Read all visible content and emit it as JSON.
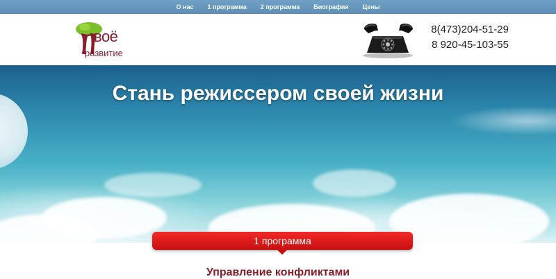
{
  "nav": {
    "items": [
      {
        "label": "О нас"
      },
      {
        "label": "1 программа"
      },
      {
        "label": "2 программа"
      },
      {
        "label": "Биография"
      },
      {
        "label": "Цены"
      }
    ]
  },
  "header": {
    "logo": {
      "word1": "воё",
      "word2": "развитие"
    },
    "phones": [
      "8(473)204-51-29",
      "8 920-45-103-55"
    ]
  },
  "hero": {
    "title": "Стань режиссером своей жизни"
  },
  "program": {
    "tab_label": "1 программа",
    "heading": "Управление конфликтами"
  },
  "colors": {
    "nav_bg": "#6fa1c6",
    "brand_dark_red": "#8a1d2a",
    "tab_red": "#e21e1c",
    "logo_green": "#7bbf2a"
  }
}
